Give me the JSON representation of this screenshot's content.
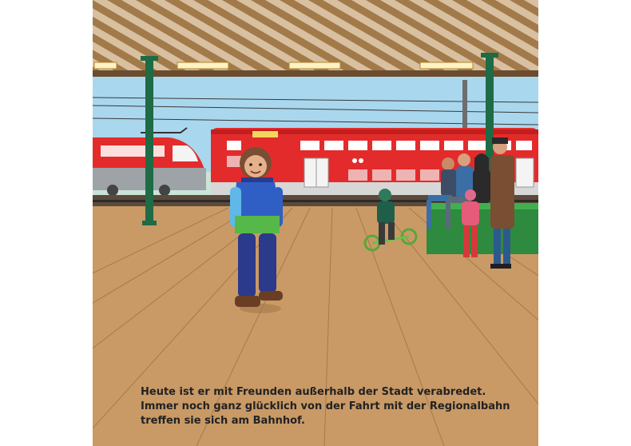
{
  "caption": {
    "lines": [
      "Heute ist er mit Freunden außerhalb der Stadt verabredet.",
      "Immer noch ganz glücklich von der Fahrt mit der Regionalbahn",
      "treffen sie sich am Bahnhof."
    ]
  },
  "colors": {
    "page_background": "#ffffff",
    "roof_wood": "#a27a4a",
    "sky": "#a9d7ee",
    "train_red": "#e42b2b",
    "pillar_green": "#1e6b45",
    "platform_floor": "#c99a66",
    "caption_text": "#222222"
  },
  "scene": {
    "elements": [
      "wooden-roof",
      "ceiling-lamps",
      "overhead-wires",
      "high-speed-train",
      "double-deck-regional-train",
      "green-pillars",
      "wooden-platform",
      "child-in-snowsuit",
      "child-on-balance-bike",
      "group-of-people-on-bench",
      "platform-shadows"
    ]
  }
}
